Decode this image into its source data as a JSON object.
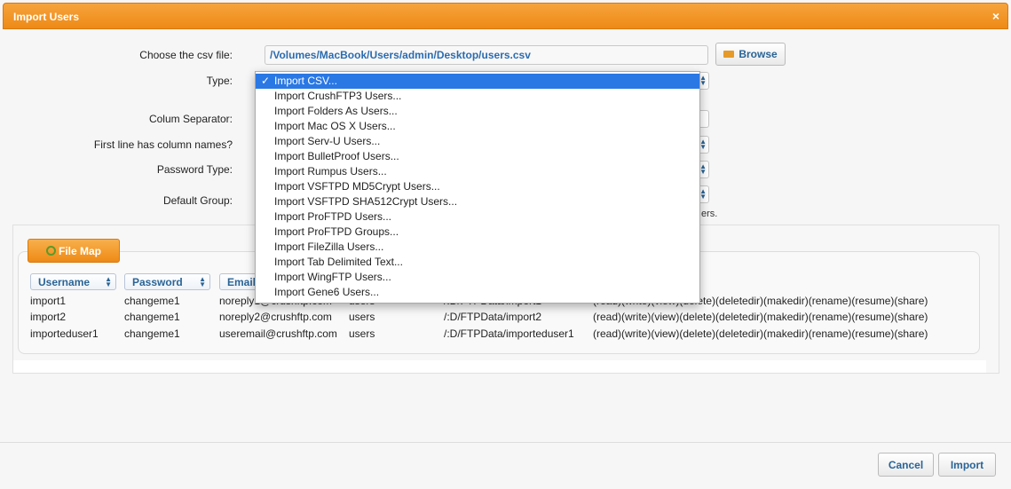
{
  "dialog": {
    "title": "Import Users",
    "close": "×"
  },
  "form": {
    "csv_label": "Choose the csv file:",
    "csv_path": "/Volumes/MacBook/Users/admin/Desktop/users.csv",
    "browse": "Browse",
    "type_label": "Type:",
    "separator_label": "Colum Separator:",
    "firstline_label": "First line has column names?",
    "password_type_label": "Password Type:",
    "default_group_label": "Default Group:",
    "note_tail": "ers."
  },
  "type_options": [
    "Import CSV...",
    "Import CrushFTP3 Users...",
    "Import Folders As Users...",
    "Import Mac OS X Users...",
    "Import Serv-U Users...",
    "Import BulletProof Users...",
    "Import Rumpus Users...",
    "Import VSFTPD MD5Crypt Users...",
    "Import VSFTPD SHA512Crypt Users...",
    "Import ProFTPD Users...",
    "Import ProFTPD Groups...",
    "Import FileZilla Users...",
    "Import Tab Delimited Text...",
    "Import WingFTP Users...",
    "Import Gene6 Users..."
  ],
  "selected_type_check": "✓",
  "filemap": {
    "button": "File Map",
    "columns": [
      "Username",
      "Password",
      "Email"
    ],
    "rows": [
      {
        "username": "import1",
        "password": "changeme1",
        "email": "noreply1@crushftp.com",
        "group": "users",
        "path": "/:D/FTPData/import1",
        "perms": "(read)(write)(view)(delete)(deletedir)(makedir)(rename)(resume)(share)"
      },
      {
        "username": "import2",
        "password": "changeme1",
        "email": "noreply2@crushftp.com",
        "group": "users",
        "path": "/:D/FTPData/import2",
        "perms": "(read)(write)(view)(delete)(deletedir)(makedir)(rename)(resume)(share)"
      },
      {
        "username": "importeduser1",
        "password": "changeme1",
        "email": "useremail@crushftp.com",
        "group": "users",
        "path": "/:D/FTPData/importeduser1",
        "perms": "(read)(write)(view)(delete)(deletedir)(makedir)(rename)(resume)(share)"
      }
    ]
  },
  "footer": {
    "cancel": "Cancel",
    "import": "Import"
  }
}
